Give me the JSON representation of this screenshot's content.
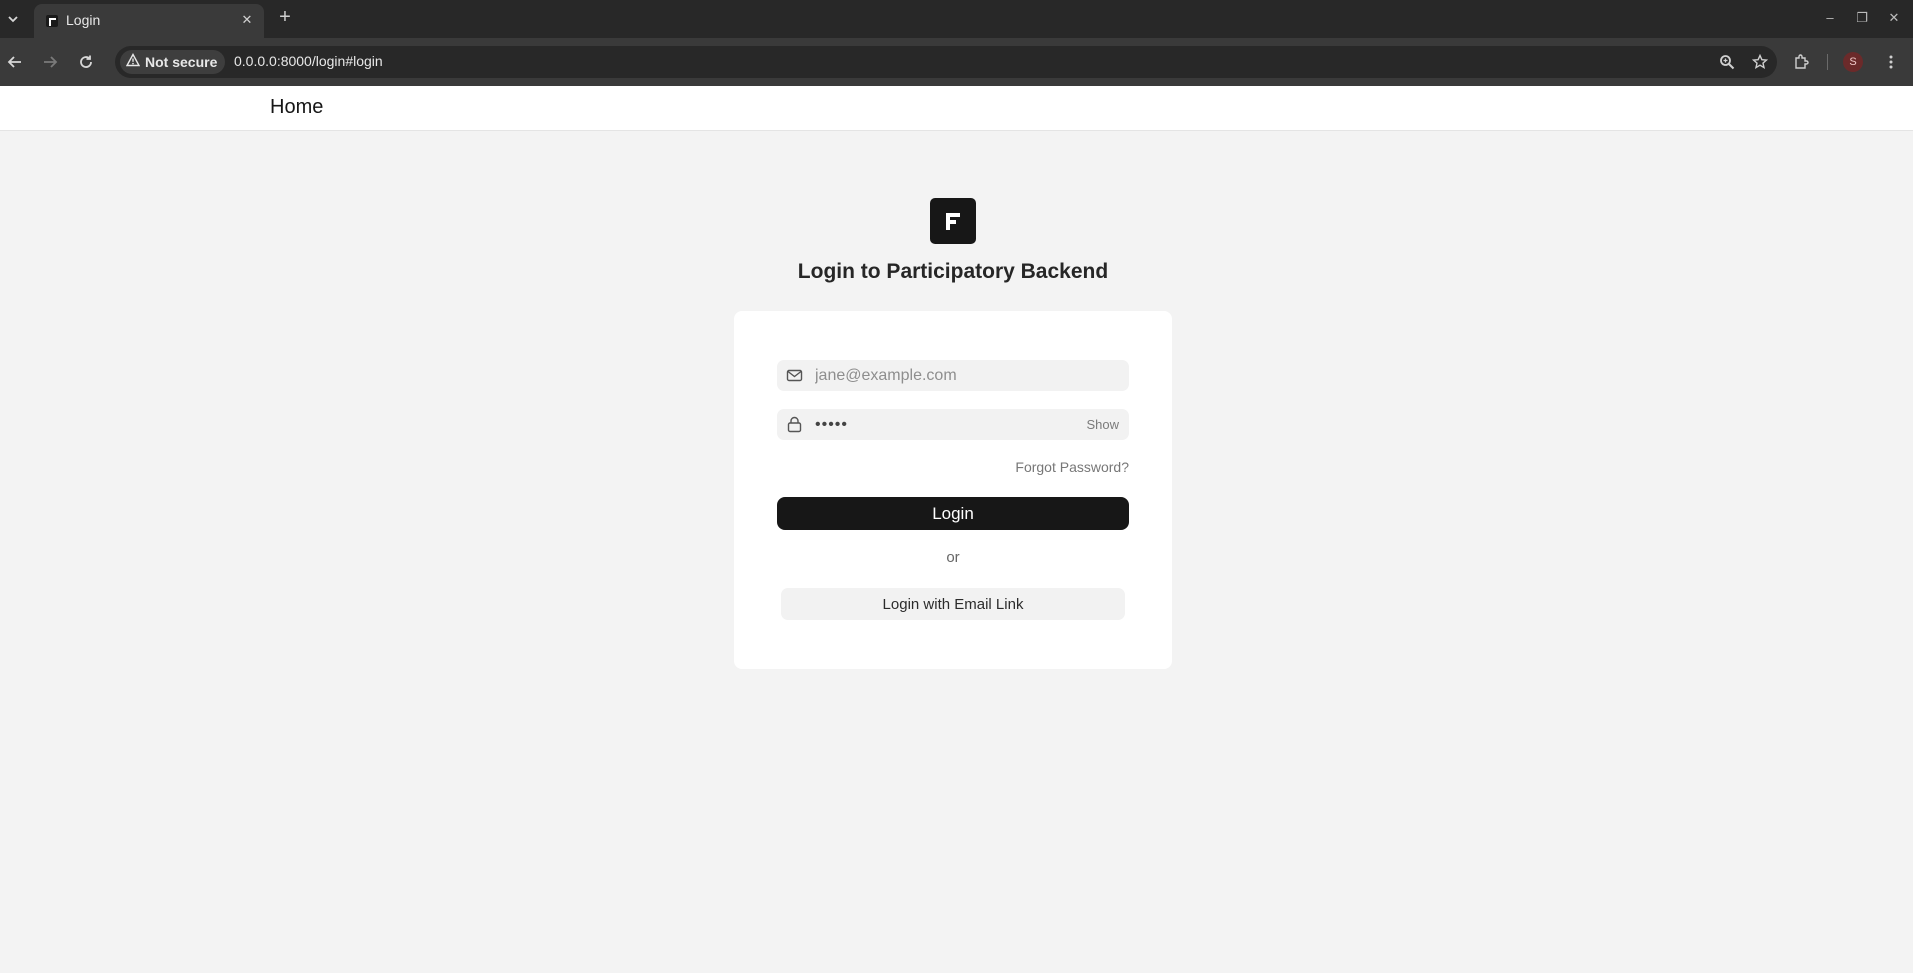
{
  "browser": {
    "tab_title": "Login",
    "security_label": "Not secure",
    "url": "0.0.0.0:8000/login#login",
    "profile_initial": "S"
  },
  "header": {
    "home_label": "Home"
  },
  "login": {
    "heading": "Login to Participatory Backend",
    "email_placeholder": "jane@example.com",
    "password_value": "•••••",
    "show_label": "Show",
    "forgot_label": "Forgot Password?",
    "login_label": "Login",
    "or_label": "or",
    "email_link_label": "Login with Email Link"
  }
}
